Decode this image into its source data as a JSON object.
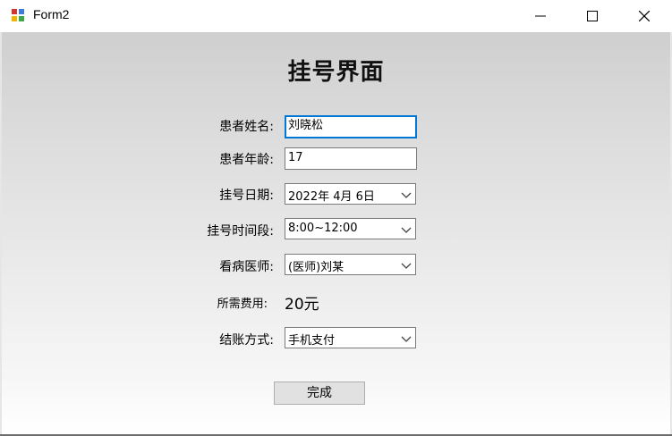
{
  "window": {
    "title": "Form2"
  },
  "heading": "挂号界面",
  "fields": {
    "patient_name": {
      "label": "患者姓名:",
      "value": "刘晓松"
    },
    "patient_age": {
      "label": "患者年龄:",
      "value": "17"
    },
    "reg_date": {
      "label": "挂号日期:",
      "value": "2022年 4月 6日"
    },
    "time_slot": {
      "label": "挂号时间段:",
      "value": "8:00~12:00"
    },
    "doctor": {
      "label": "看病医师:",
      "value": "(医师)刘某"
    },
    "fee": {
      "label": "所需费用:",
      "value": "20元"
    },
    "payment": {
      "label": "结账方式:",
      "value": "手机支付"
    }
  },
  "buttons": {
    "done": "完成"
  },
  "icons": [
    "app-icon",
    "minimize-icon",
    "maximize-icon",
    "close-icon",
    "chevron-down-icon"
  ]
}
